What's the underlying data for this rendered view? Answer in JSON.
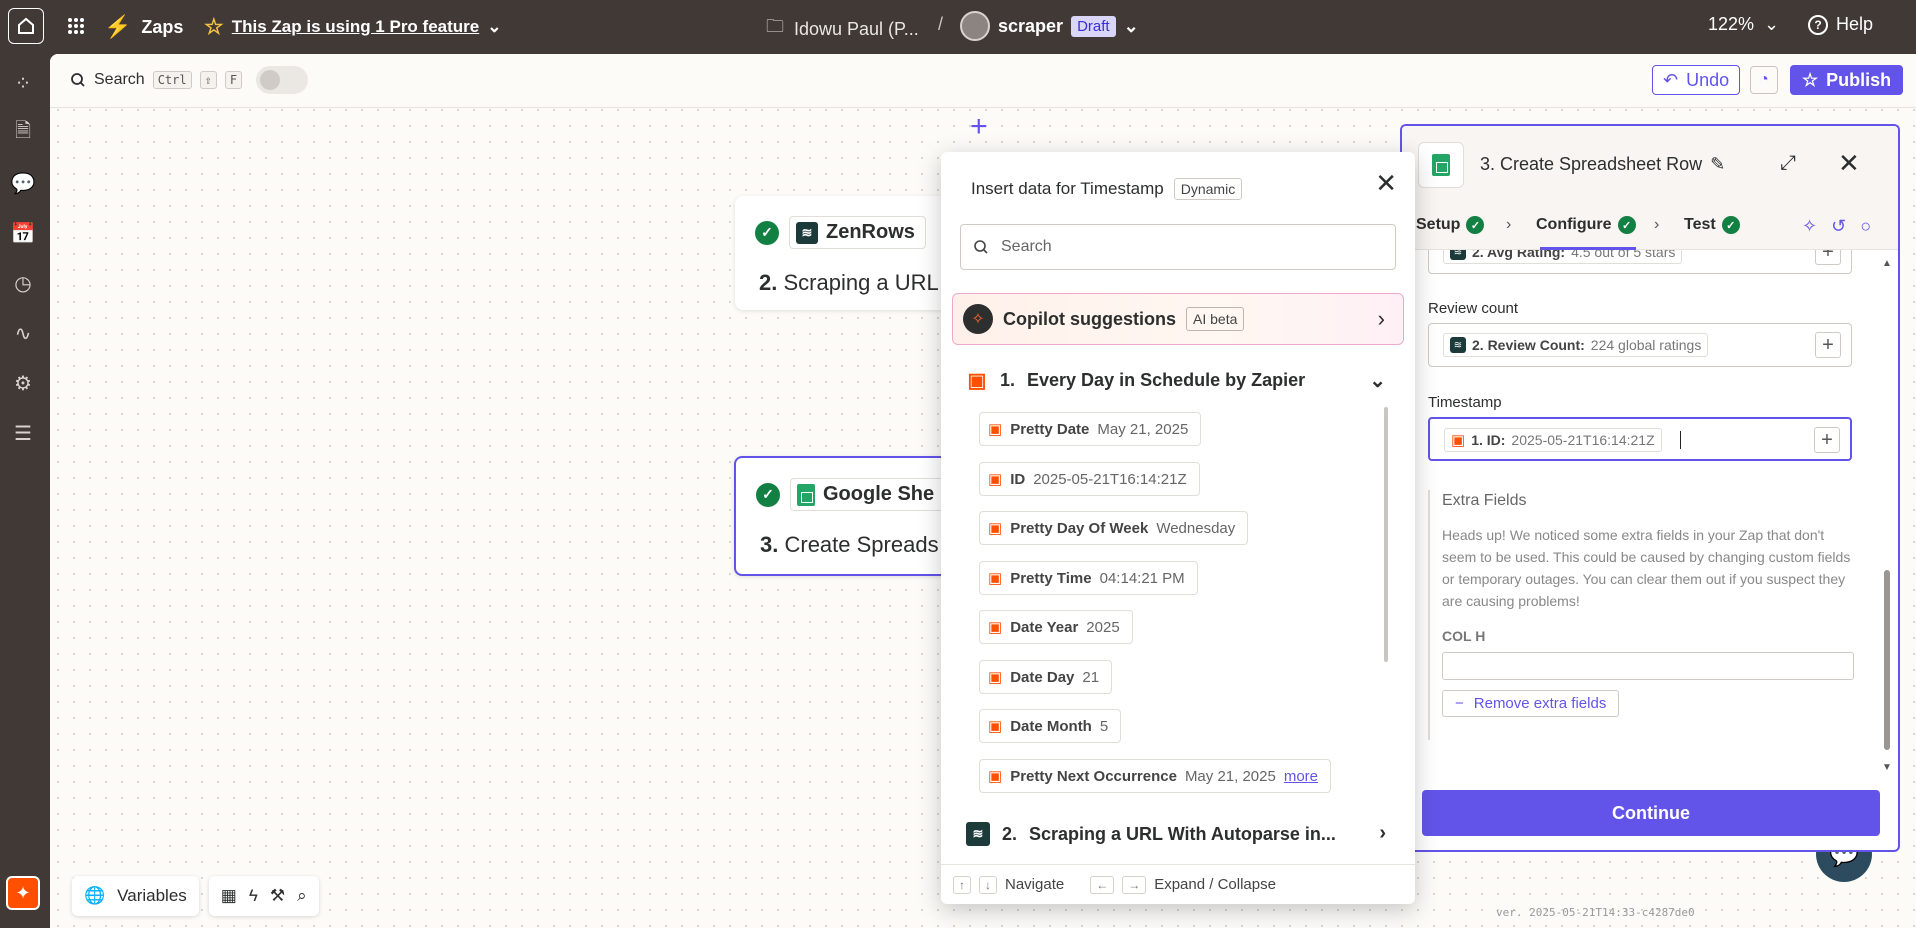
{
  "topbar": {
    "home_icon": "home-icon",
    "apps_icon": "grid-icon",
    "brand": "Zaps",
    "pro_feature": "This Zap is using 1 Pro feature",
    "folder": "Idowu Paul (P...",
    "separator": "/",
    "zap_name": "scraper",
    "status": "Draft",
    "zoom": "122%",
    "help": "Help"
  },
  "toolbar": {
    "search_label": "Search",
    "shortcut": [
      "Ctrl",
      "⇧",
      "F"
    ],
    "undo": "Undo",
    "publish": "Publish"
  },
  "nodes": [
    {
      "app": "ZenRows",
      "number": "2.",
      "title": "Scraping a URL"
    },
    {
      "app": "Google She",
      "number": "3.",
      "title": "Create Spreads"
    }
  ],
  "popover": {
    "title": "Insert data for Timestamp",
    "badge": "Dynamic",
    "search_placeholder": "Search",
    "copilot": {
      "label": "Copilot suggestions",
      "badge": "AI beta"
    },
    "section1": {
      "number": "1.",
      "title": "Every Day in Schedule by Zapier"
    },
    "items": [
      {
        "key": "Pretty Date",
        "value": "May 21, 2025"
      },
      {
        "key": "ID",
        "value": "2025-05-21T16:14:21Z"
      },
      {
        "key": "Pretty Day Of Week",
        "value": "Wednesday"
      },
      {
        "key": "Pretty Time",
        "value": "04:14:21 PM"
      },
      {
        "key": "Date Year",
        "value": "2025"
      },
      {
        "key": "Date Day",
        "value": "21"
      },
      {
        "key": "Date Month",
        "value": "5"
      },
      {
        "key": "Pretty Next Occurrence",
        "value": "May 21, 2025",
        "more": "more"
      }
    ],
    "section2": {
      "number": "2.",
      "title": "Scraping a URL With Autoparse in..."
    },
    "footer": {
      "navigate": "Navigate",
      "expand": "Expand / Collapse",
      "up": "↑",
      "down": "↓",
      "left": "←",
      "right": "→"
    }
  },
  "panel": {
    "title": "3. Create Spreadsheet Row",
    "tabs": [
      "Setup",
      "Configure",
      "Test"
    ],
    "avg_rating": {
      "key": "2. Avg Rating:",
      "value": "4.5 out of 5 stars"
    },
    "review_count": {
      "label": "Review count",
      "key": "2. Review Count:",
      "value": "224 global ratings"
    },
    "timestamp": {
      "label": "Timestamp",
      "key": "1. ID:",
      "value": "2025-05-21T16:14:21Z"
    },
    "extra": {
      "title": "Extra Fields",
      "text": "Heads up! We noticed some extra fields in your Zap that don't seem to be used. This could be caused by changing custom fields or temporary outages. You can clear them out if you suspect they are causing problems!",
      "col_label": "COL H",
      "remove": "Remove extra fields"
    },
    "continue": "Continue"
  },
  "bottom": {
    "variables": "Variables"
  },
  "version": "ver. 2025-05-21T14:33-c4287de0",
  "colors": {
    "accent": "#6254e8",
    "brand": "#ff4f00",
    "success": "#138043"
  }
}
